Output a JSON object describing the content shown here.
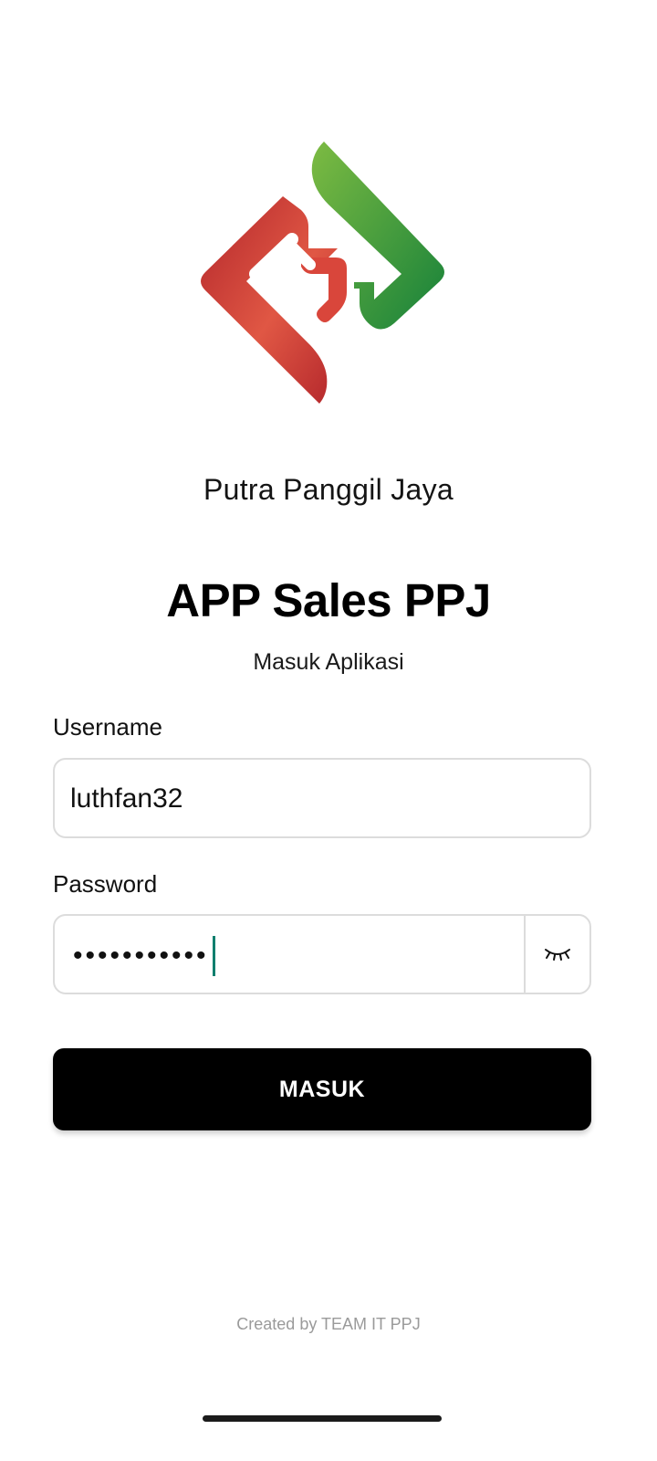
{
  "logo": {
    "icon": "ppj-logo-icon",
    "colors": {
      "red": "#d9463b",
      "dark_red": "#b3262b",
      "green": "#6db33f",
      "dark_green": "#1e8a3c"
    }
  },
  "company_name": "Putra Panggil Jaya",
  "app_title": "APP Sales PPJ",
  "subtitle": "Masuk Aplikasi",
  "form": {
    "username_label": "Username",
    "username_value": "luthfan32",
    "password_label": "Password",
    "password_masked": "•••••••••••",
    "toggle_icon": "eye-closed-icon",
    "submit_label": "MASUK"
  },
  "footer": "Created by TEAM IT PPJ",
  "colors": {
    "caret": "#0f7f6e",
    "button": "#000000",
    "field_border": "#dcdcdc"
  }
}
